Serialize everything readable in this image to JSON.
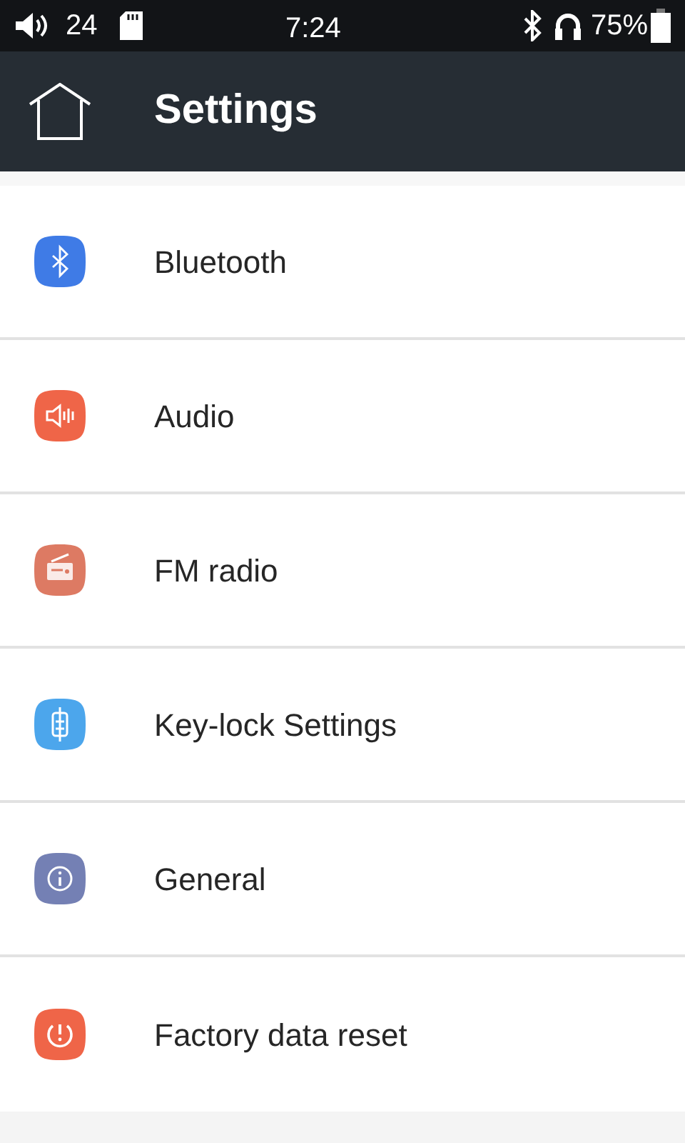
{
  "status_bar": {
    "volume": "24",
    "time": "7:24",
    "battery": "75%"
  },
  "header": {
    "title": "Settings"
  },
  "items": [
    {
      "label": "Bluetooth",
      "kind": "bluetooth",
      "color": "#3f7be6"
    },
    {
      "label": "Audio",
      "kind": "speaker",
      "color": "#ef6548"
    },
    {
      "label": "FM radio",
      "kind": "radio",
      "color": "#dd7a63"
    },
    {
      "label": "Key-lock Settings",
      "kind": "keylock",
      "color": "#4ca6ec"
    },
    {
      "label": "General",
      "kind": "info",
      "color": "#7480b4"
    },
    {
      "label": "Factory data reset",
      "kind": "reset",
      "color": "#ef6548"
    }
  ]
}
